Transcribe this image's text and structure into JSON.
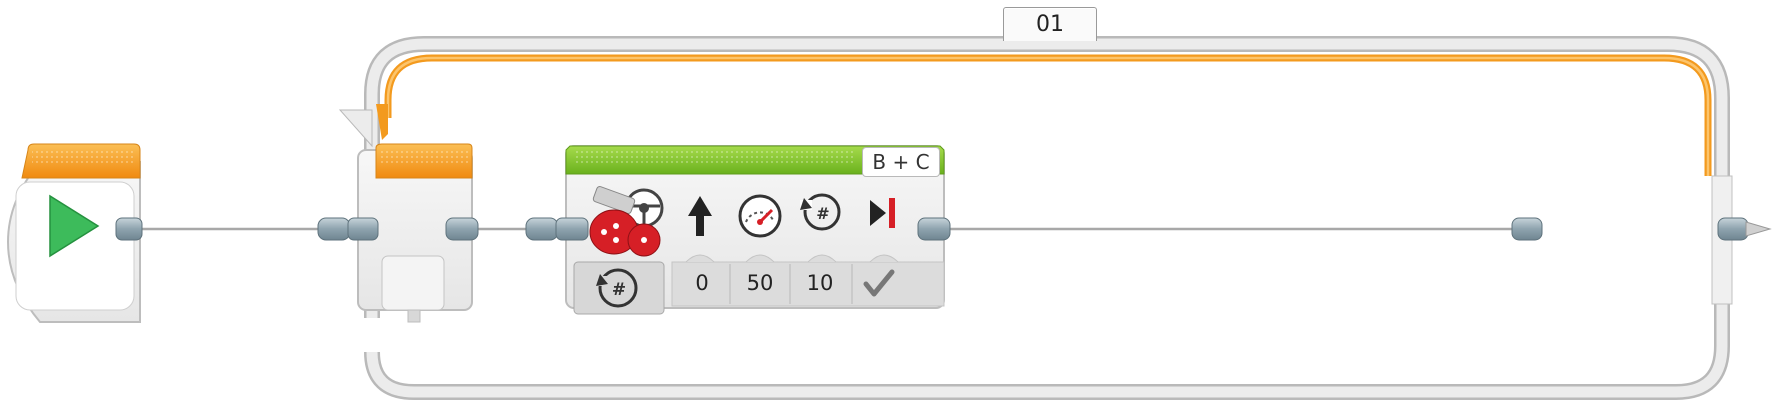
{
  "loop": {
    "label": "01",
    "colors": {
      "frame": "#d9d9d9",
      "frame_edge": "#b7b7b7",
      "accent": "#f39a1e"
    }
  },
  "start_block": {
    "icon": "play-triangle-icon",
    "colors": {
      "header": "#f7a21b",
      "icon": "#3dbb5b"
    }
  },
  "move_steering_block": {
    "port_label": "B + C",
    "mode_icon": "rotations-mode-icon",
    "block_icon": "steering-motor-icon",
    "colors": {
      "header": "#7ac321"
    },
    "params": [
      {
        "icon": "steering-arrow-icon",
        "value": "0"
      },
      {
        "icon": "power-gauge-icon",
        "value": "50"
      },
      {
        "icon": "rotations-icon",
        "value": "10"
      },
      {
        "icon": "brake-at-end-icon",
        "value": "check-icon"
      }
    ]
  }
}
